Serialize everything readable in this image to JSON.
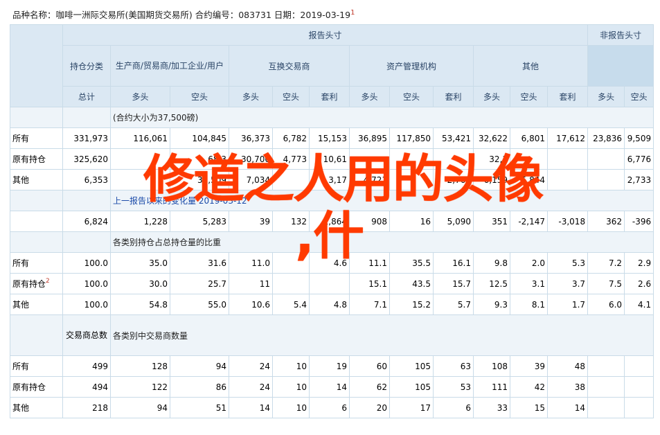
{
  "header": {
    "line": "品种名称：咖啡一洲际交易所(美国期货交易所)  合约编号：083731  日期：2019-03-19",
    "footnote": "1"
  },
  "table": {
    "report_header": "报告头寸",
    "nonreport_header": "非报告头寸",
    "position_class": "持仓分类",
    "group_producer": "生产商/贸易商/加工企业/用户",
    "group_swap": "互换交易商",
    "group_asset": "资产管理机构",
    "group_other": "其他",
    "col_total": "总计",
    "col_long": "多头",
    "col_short": "空头",
    "col_spread": "套利",
    "contract_note": "(合约大小为37,500磅)",
    "change_note": "上一报告以来的变化量 2019-03-12",
    "pct_note": "各类别持仓占总持仓量的比重",
    "traders_note": "各类别中交易商数量",
    "traders_total_label": "交易商总数",
    "rows_positions": [
      {
        "label": "所有",
        "sup": "",
        "v": [
          "331,973",
          "116,061",
          "104,845",
          "36,373",
          "6,782",
          "15,153",
          "36,895",
          "117,850",
          "53,421",
          "32,622",
          "6,801",
          "17,612",
          "23,836",
          "9,509"
        ]
      },
      {
        "label": "原有持仓",
        "sup": "",
        "v": [
          "325,620",
          "",
          "68,3",
          "30,700",
          "4,773",
          "10,61",
          "",
          "",
          "",
          "32,3",
          "",
          "",
          "",
          "6,776"
        ]
      },
      {
        "label": "其他",
        "sup": "",
        "v": [
          "6,353",
          "",
          "36,509",
          "7,034",
          "",
          "3,17",
          "4,721",
          "",
          "2,769",
          "6,159",
          "5,844",
          "",
          "",
          "2,733"
        ]
      }
    ],
    "change_row": [
      "6,824",
      "1,228",
      "5,283",
      "39",
      "132",
      "1,864",
      "908",
      "16",
      "5,090",
      "351",
      "-2,147",
      "-3,018",
      "362",
      "-396"
    ],
    "rows_pct": [
      {
        "label": "所有",
        "sup": "",
        "v": [
          "100.0",
          "35.0",
          "31.6",
          "11.0",
          "",
          "4.6",
          "11.1",
          "35.5",
          "16.1",
          "9.8",
          "2.0",
          "5.3",
          "7.2",
          "2.9"
        ]
      },
      {
        "label": "原有持仓",
        "sup": "2",
        "v": [
          "100.0",
          "30.0",
          "25.7",
          "11",
          "",
          "",
          "15.1",
          "43.5",
          "15.7",
          "12.5",
          "3.1",
          "3.7",
          "7.5",
          "2.6"
        ]
      },
      {
        "label": "其他",
        "sup": "",
        "v": [
          "100.0",
          "54.8",
          "55.0",
          "10.6",
          "5.4",
          "4.8",
          "7.1",
          "15.2",
          "5.7",
          "9.3",
          "8.1",
          "1.7",
          "6.0",
          "4.1"
        ]
      }
    ],
    "rows_traders": [
      {
        "label": "所有",
        "sup": "",
        "v": [
          "499",
          "128",
          "94",
          "24",
          "10",
          "19",
          "60",
          "105",
          "63",
          "108",
          "39",
          "48",
          "",
          ""
        ]
      },
      {
        "label": "原有持仓",
        "sup": "",
        "v": [
          "494",
          "122",
          "86",
          "24",
          "10",
          "14",
          "62",
          "105",
          "53",
          "111",
          "42",
          "38",
          "",
          ""
        ]
      },
      {
        "label": "其他",
        "sup": "",
        "v": [
          "218",
          "94",
          "51",
          "14",
          "10",
          "6",
          "20",
          "17",
          "6",
          "33",
          "15",
          "14",
          "",
          ""
        ]
      }
    ]
  },
  "overlay_text": {
    "line1": "修道之人用的头像",
    "line2": ",什"
  }
}
